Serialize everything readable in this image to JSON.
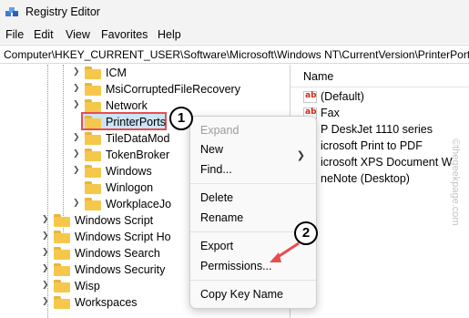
{
  "window": {
    "title": "Registry Editor"
  },
  "menu": [
    "File",
    "Edit",
    "View",
    "Favorites",
    "Help"
  ],
  "address": "Computer\\HKEY_CURRENT_USER\\Software\\Microsoft\\Windows NT\\CurrentVersion\\PrinterPorts",
  "tree": {
    "subkeys": [
      {
        "label": "ICM",
        "expandable": true
      },
      {
        "label": "MsiCorruptedFileRecovery",
        "expandable": true
      },
      {
        "label": "Network",
        "expandable": true
      },
      {
        "label": "PrinterPorts",
        "expandable": false,
        "selected": true
      },
      {
        "label": "TileDataMod",
        "expandable": true
      },
      {
        "label": "TokenBroker",
        "expandable": true
      },
      {
        "label": "Windows",
        "expandable": true
      },
      {
        "label": "Winlogon",
        "expandable": false
      },
      {
        "label": "WorkplaceJo",
        "expandable": true
      }
    ],
    "parents": [
      {
        "label": "Windows Script",
        "expandable": true
      },
      {
        "label": "Windows Script Ho",
        "expandable": true
      },
      {
        "label": "Windows Search",
        "expandable": true
      },
      {
        "label": "Windows Security",
        "expandable": true
      },
      {
        "label": "Wisp",
        "expandable": true
      },
      {
        "label": "Workspaces",
        "expandable": true
      }
    ]
  },
  "values": {
    "header": "Name",
    "rows": [
      "(Default)",
      "Fax",
      "P DeskJet 1110 series",
      "icrosoft Print to PDF",
      "icrosoft XPS Document W",
      "neNote (Desktop)"
    ]
  },
  "context_menu": {
    "items": [
      {
        "label": "Expand",
        "disabled": true
      },
      {
        "label": "New",
        "submenu": true
      },
      {
        "label": "Find..."
      },
      {
        "label": "Delete"
      },
      {
        "label": "Rename"
      },
      {
        "label": "Export"
      },
      {
        "label": "Permissions..."
      },
      {
        "label": "Copy Key Name"
      }
    ]
  },
  "annotations": {
    "step1": "1",
    "step2": "2"
  },
  "watermark": "©thegeekpage.com",
  "colors": {
    "highlight": "#e84c50",
    "selection": "#cce4f7",
    "folder": "#f5c84c"
  }
}
